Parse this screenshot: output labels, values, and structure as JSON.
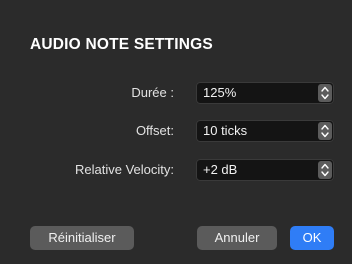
{
  "dialog": {
    "title": "AUDIO NOTE SETTINGS"
  },
  "fields": [
    {
      "label": "Durée :",
      "value": "125%"
    },
    {
      "label": "Offset:",
      "value": "10 ticks"
    },
    {
      "label": "Relative Velocity:",
      "value": "+2 dB"
    }
  ],
  "buttons": {
    "reset": "Réinitialiser",
    "cancel": "Annuler",
    "ok": "OK"
  },
  "colors": {
    "background": "#2b2b2b",
    "field_background": "#141414",
    "button_background": "#5b5b5b",
    "accent": "#2f7df6"
  },
  "icons": {
    "stepper": "up-down-chevron-icon"
  }
}
